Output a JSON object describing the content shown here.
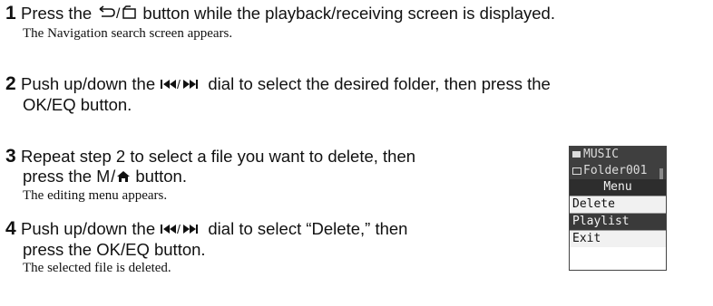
{
  "steps": [
    {
      "number": "1",
      "line1_pre": "Press the ",
      "button_glyph": "⮌/▭",
      "line1_post": " button while the playback/receiving screen is displayed.",
      "note": "The Navigation search screen appears."
    },
    {
      "number": "2",
      "line1_pre": "Push up/down the ",
      "dial_glyph": "◀◀/▶▶",
      "line1_post": " dial to select the desired folder, then press the",
      "line2": "OK/EQ button."
    },
    {
      "number": "3",
      "line1": "Repeat step 2 to select a file you want to delete, then",
      "line2_pre": "press the ",
      "button_glyph": "M/",
      "line2_post": " button.",
      "note": "The editing menu appears."
    },
    {
      "number": "4",
      "line1_pre": "Push up/down the ",
      "dial_glyph": "◀◀/▶▶",
      "line1_post": " dial to select “Delete,” then",
      "line2": "press the OK/EQ button.",
      "note": "The selected file is deleted."
    }
  ],
  "device_screen": {
    "folder_header": "MUSIC",
    "folder_item": "Folder001",
    "menu_title": "Menu",
    "items": [
      "Delete",
      "Playlist",
      "Exit"
    ],
    "selected_item": "Playlist"
  }
}
